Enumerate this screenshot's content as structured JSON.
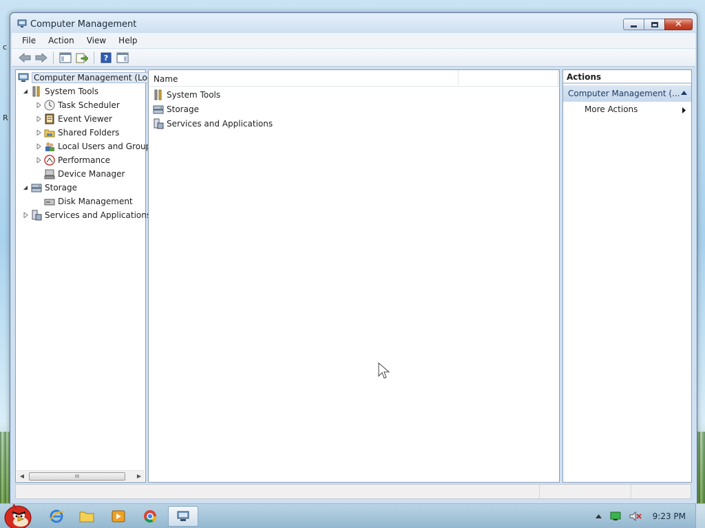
{
  "window": {
    "title": "Computer Management",
    "title_icon": "computer-management-icon",
    "buttons": [
      "minimize",
      "maximize",
      "close"
    ]
  },
  "menu": [
    "File",
    "Action",
    "View",
    "Help"
  ],
  "toolbar": {
    "buttons": [
      "back-arrow-icon",
      "forward-arrow-icon",
      "show-hide-console-tree-icon",
      "export-list-icon",
      "help-icon",
      "show-hide-action-pane-icon"
    ]
  },
  "tree": {
    "root": "Computer Management (Loca",
    "items": [
      {
        "label": "System Tools",
        "icon": "tools-icon",
        "expanded": true
      },
      {
        "label": "Task Scheduler",
        "icon": "clock-icon"
      },
      {
        "label": "Event Viewer",
        "icon": "event-viewer-icon"
      },
      {
        "label": "Shared Folders",
        "icon": "shared-folders-icon"
      },
      {
        "label": "Local Users and Group",
        "icon": "users-icon"
      },
      {
        "label": "Performance",
        "icon": "performance-icon"
      },
      {
        "label": "Device Manager",
        "icon": "device-manager-icon"
      },
      {
        "label": "Storage",
        "icon": "storage-icon",
        "expanded": true
      },
      {
        "label": "Disk Management",
        "icon": "disk-icon"
      },
      {
        "label": "Services and Applications",
        "icon": "services-icon"
      }
    ],
    "scroll_glyph": "III"
  },
  "list": {
    "column_name": "Name",
    "rows": [
      "System Tools",
      "Storage",
      "Services and Applications"
    ]
  },
  "actions": {
    "header": "Actions",
    "group": "Computer Management (...",
    "items": [
      "More Actions"
    ]
  },
  "taskbar": {
    "apps": [
      "angry-birds-start-orb",
      "internet-explorer-icon",
      "folder-icon",
      "media-player-icon",
      "chrome-icon",
      "computer-management-icon"
    ],
    "clock": "9:23 PM"
  },
  "desktop": {
    "edge_label": "R",
    "edge_label_top": "c"
  }
}
